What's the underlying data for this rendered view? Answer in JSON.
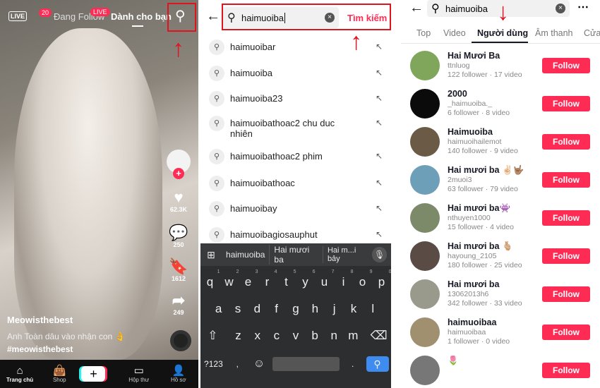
{
  "feed": {
    "tabs": [
      "Đang Follow",
      "Dành cho bạn"
    ],
    "live_icon": "LIVE",
    "badge_count": "20",
    "live_badge": "LIVE",
    "likes": "62.3K",
    "comments": "250",
    "saves": "1612",
    "shares": "249",
    "author": "Meowisthebest",
    "caption": "Anh Toàn dâu vào nhận con 👌",
    "hashtag": "#meowisthebest",
    "nav": [
      "Trang chủ",
      "Shop",
      "+",
      "Hộp thư",
      "Hồ sơ"
    ]
  },
  "search": {
    "query": "haimuoiba",
    "submit": "Tìm kiếm",
    "suggestions": [
      {
        "prefix": "haimuoiba",
        "rest": "r"
      },
      {
        "prefix": "haimuoiba",
        "rest": ""
      },
      {
        "prefix": "haimuoiba",
        "rest": "23"
      },
      {
        "prefix": "haimuoiba",
        "rest": "thoac2 chu duc nhiên"
      },
      {
        "prefix": "haimuoiba",
        "rest": "thoac2 phim"
      },
      {
        "prefix": "haimuoiba",
        "rest": "thoac"
      },
      {
        "prefix": "haimuoiba",
        "rest": "y"
      },
      {
        "prefix": "haimuoiba",
        "rest": "giosauphut"
      }
    ],
    "keyboard": {
      "predictions": [
        "haimuoiba",
        "Hai mươi ba",
        "Hai m...i bảy"
      ],
      "row1": [
        "q",
        "w",
        "e",
        "r",
        "t",
        "y",
        "u",
        "i",
        "o",
        "p"
      ],
      "row1_nums": [
        "1",
        "2",
        "3",
        "4",
        "5",
        "6",
        "7",
        "8",
        "9",
        "0"
      ],
      "row2": [
        "a",
        "s",
        "d",
        "f",
        "g",
        "h",
        "j",
        "k",
        "l"
      ],
      "row3": [
        "z",
        "x",
        "c",
        "v",
        "b",
        "n",
        "m"
      ],
      "symbols": "?123",
      "comma": ",",
      "period": "."
    }
  },
  "results": {
    "query": "haimuoiba",
    "tabs": [
      "Top",
      "Video",
      "Người dùng",
      "Âm thanh",
      "Cửa"
    ],
    "active_tab": "Người dùng",
    "follow_label": "Follow",
    "users": [
      {
        "name": "Hai  Mươi  Ba",
        "handle": "ttnluog",
        "meta": "122 follower · 17 video",
        "color": "#7fa65a"
      },
      {
        "name": "2000",
        "handle": "_haimuoiba._",
        "meta": "6 follower · 8 video",
        "color": "#0b0b0b"
      },
      {
        "name": "Haimuoiba",
        "handle": "haimuoihailemot",
        "meta": "140 follower · 9 video",
        "color": "#6b5a45"
      },
      {
        "name": "Hai mươi ba ✌🏻🤟🏽",
        "handle": "2muoi3",
        "meta": "63 follower · 79 video",
        "color": "#6e9fb8"
      },
      {
        "name": "Hai mươi ba👾",
        "handle": "nthuyen1000",
        "meta": "15 follower · 4 video",
        "color": "#7d8a6a"
      },
      {
        "name": "Hai  mươi  ba  🫰🏼",
        "handle": "hayoung_2105",
        "meta": "180 follower · 25 video",
        "color": "#5a4b45"
      },
      {
        "name": "Hai mươi ba",
        "handle": "13062013h6",
        "meta": "342 follower · 33 video",
        "color": "#9a9a8c"
      },
      {
        "name": "haimuoibaa",
        "handle": "haimuoibaa",
        "meta": "1 follower · 0 video",
        "color": "#a09070"
      },
      {
        "name": "🌷",
        "handle": "",
        "meta": "",
        "color": "#777"
      }
    ]
  },
  "colors": {
    "accent": "#fe2c55",
    "highlight": "#e0141f"
  }
}
